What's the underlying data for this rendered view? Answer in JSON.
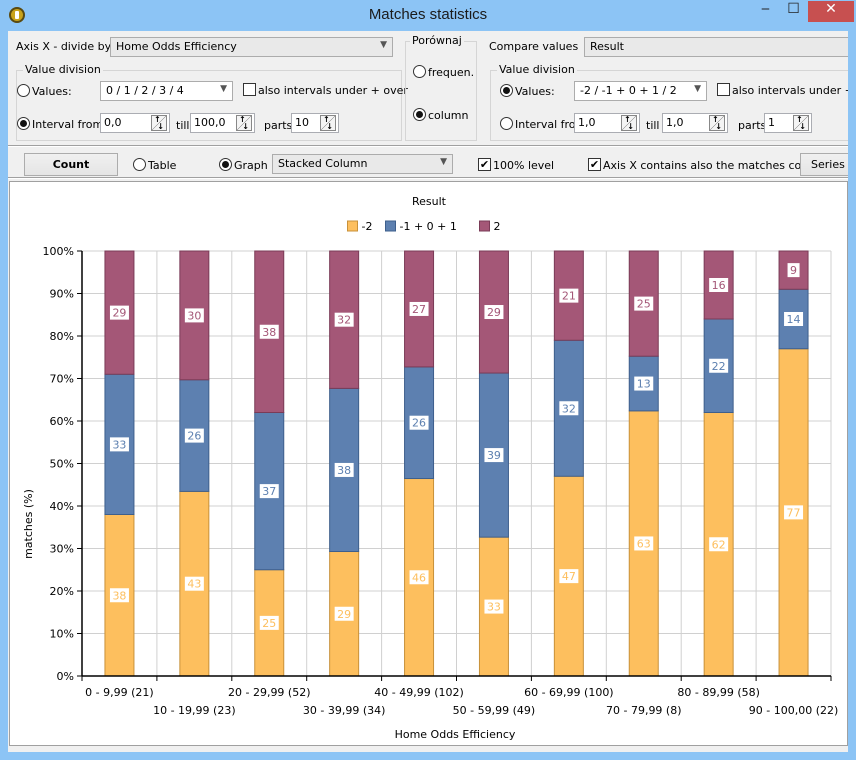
{
  "window": {
    "title": "Matches statistics",
    "minimize_glyph": "‒",
    "maximize_glyph": "☐",
    "close_glyph": "✕"
  },
  "axis_x": {
    "label": "Axis X - divide by",
    "selected": "Home Odds Efficiency",
    "value_division_title": "Value division",
    "values_label": "Values:",
    "values_selected": "0 / 1 / 2 / 3 / 4",
    "values_radio_checked": false,
    "also_intervals_label": "also intervals under + over",
    "also_intervals_checked": false,
    "interval_label": "Interval from",
    "interval_radio_checked": true,
    "interval_from": "0,0",
    "till_label": "till",
    "interval_till": "100,0",
    "parts_label": "parts",
    "parts": "10"
  },
  "compare_mode": {
    "title": "Porównaj",
    "frequen_label": "frequen.",
    "frequen_checked": false,
    "column_label": "column",
    "column_checked": true
  },
  "compare_values": {
    "label": "Compare values",
    "selected": "Result",
    "value_division_title": "Value division",
    "values_label": "Values:",
    "values_selected": "-2 / -1 + 0 + 1 / 2",
    "values_radio_checked": true,
    "also_intervals_label": "also intervals under + over",
    "also_intervals_checked": false,
    "interval_label": "Interval from",
    "interval_radio_checked": false,
    "interval_from": "1,0",
    "till_label": "till",
    "interval_till": "1,0",
    "parts_label": "parts",
    "parts": "1"
  },
  "toolbar": {
    "count_label": "Count",
    "table_label": "Table",
    "table_checked": false,
    "graph_label": "Graph",
    "graph_checked": true,
    "graph_type": "Stacked Column",
    "level100_label": "100% level",
    "level100_checked": true,
    "axis_count_label": "Axis X contains also the matches count",
    "axis_count_checked": true,
    "series_label": "Series ..."
  },
  "chart_data": {
    "type": "bar",
    "stacked": true,
    "percent_stacked": true,
    "title": "Result",
    "xlabel": "Home Odds Efficiency",
    "ylabel": "matches (%)",
    "ylim": [
      0,
      100
    ],
    "yticks": [
      "0%",
      "10%",
      "20%",
      "30%",
      "40%",
      "50%",
      "60%",
      "70%",
      "80%",
      "90%",
      "100%"
    ],
    "legend_position": "top-center",
    "grid": true,
    "categories": [
      "0 - 9,99 (21)",
      "10 - 19,99 (23)",
      "20 - 29,99 (52)",
      "30 - 39,99 (34)",
      "40 - 49,99 (102)",
      "50 - 59,99 (49)",
      "60 - 69,99 (100)",
      "70 - 79,99 (8)",
      "80 - 89,99 (58)",
      "90 - 100,00 (22)"
    ],
    "series": [
      {
        "name": "-2",
        "color": "#fdbf5e",
        "border": "#c8913a",
        "values": [
          38,
          43,
          25,
          29,
          46,
          33,
          47,
          63,
          62,
          77
        ]
      },
      {
        "name": "-1 + 0 + 1",
        "color": "#5d80b0",
        "border": "#3e5f8c",
        "values": [
          33,
          26,
          37,
          38,
          26,
          39,
          32,
          13,
          22,
          14
        ]
      },
      {
        "name": "2",
        "color": "#a45777",
        "border": "#7a3b57",
        "values": [
          29,
          30,
          38,
          32,
          27,
          29,
          21,
          25,
          16,
          9
        ]
      }
    ]
  }
}
